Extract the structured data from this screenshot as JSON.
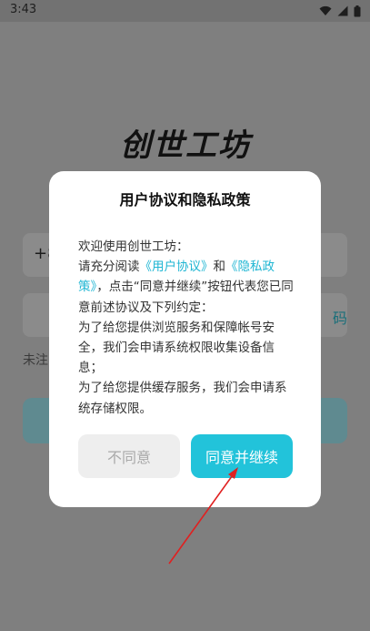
{
  "status_bar": {
    "time": "3:43"
  },
  "background": {
    "logo": "创世工坊",
    "phone_prefix": "+8",
    "code_link": "码",
    "hint_text": "未注"
  },
  "dialog": {
    "title": "用户协议和隐私政策",
    "body": {
      "line1": "欢迎使用创世工坊：",
      "p2_a": "请充分阅读",
      "user_agreement": "《用户协议》",
      "p2_b": "和",
      "privacy_policy": "《隐私政策》",
      "p2_c": "，点击“同意并继续”按钮代表您已同意前述协议及下列约定：",
      "line3": "为了给您提供浏览服务和保障帐号安全，我们会申请系统权限收集设备信息；",
      "line4": "为了给您提供缓存服务，我们会申请系统存储权限。"
    },
    "decline_label": "不同意",
    "accept_label": "同意并继续"
  },
  "colors": {
    "accent": "#22c3da",
    "link": "#1fb6d3",
    "annotation_arrow": "#e02020"
  }
}
